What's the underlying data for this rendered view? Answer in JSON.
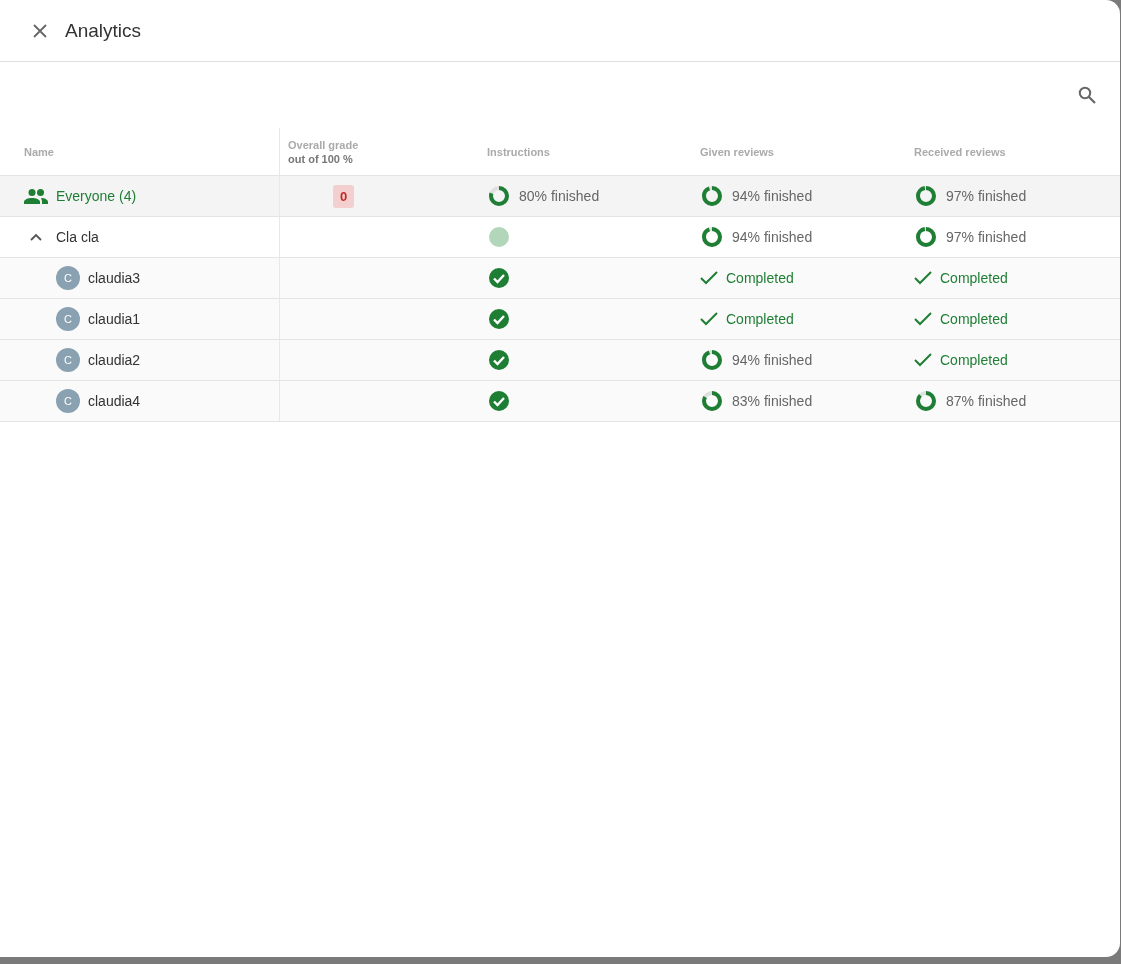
{
  "dialog": {
    "title": "Analytics"
  },
  "table": {
    "columns": [
      {
        "label": "Name"
      },
      {
        "label": "Overall grade",
        "sublabel": "out of 100 %"
      },
      {
        "label": "Instructions"
      },
      {
        "label": "Given reviews"
      },
      {
        "label": "Received reviews"
      }
    ],
    "summary_row": {
      "name": "Everyone (4)",
      "grade": "0",
      "cells": [
        {
          "kind": "ring",
          "level": 0.8,
          "text": "80% finished"
        },
        {
          "kind": "ring",
          "level": 0.94,
          "text": "94% finished"
        },
        {
          "kind": "ring",
          "level": 0.97,
          "text": "97% finished"
        }
      ]
    },
    "groups": [
      {
        "name": "Cla cla",
        "expanded": true,
        "cells": [
          {
            "kind": "dot"
          },
          {
            "kind": "ring",
            "level": 0.94,
            "text": "94% finished"
          },
          {
            "kind": "ring",
            "level": 0.97,
            "text": "97% finished"
          }
        ],
        "children": [
          {
            "initial": "C",
            "name": "claudia3",
            "cells": [
              {
                "kind": "check"
              },
              {
                "kind": "done",
                "text": "Completed"
              },
              {
                "kind": "done",
                "text": "Completed"
              }
            ]
          },
          {
            "initial": "C",
            "name": "claudia1",
            "cells": [
              {
                "kind": "check"
              },
              {
                "kind": "done",
                "text": "Completed"
              },
              {
                "kind": "done",
                "text": "Completed"
              }
            ]
          },
          {
            "initial": "C",
            "name": "claudia2",
            "cells": [
              {
                "kind": "check"
              },
              {
                "kind": "ring",
                "level": 0.94,
                "text": "94% finished"
              },
              {
                "kind": "done",
                "text": "Completed"
              }
            ]
          },
          {
            "initial": "C",
            "name": "claudia4",
            "cells": [
              {
                "kind": "check"
              },
              {
                "kind": "ring",
                "level": 0.83,
                "text": "83% finished"
              },
              {
                "kind": "ring",
                "level": 0.87,
                "text": "87% finished"
              }
            ]
          }
        ]
      }
    ]
  }
}
